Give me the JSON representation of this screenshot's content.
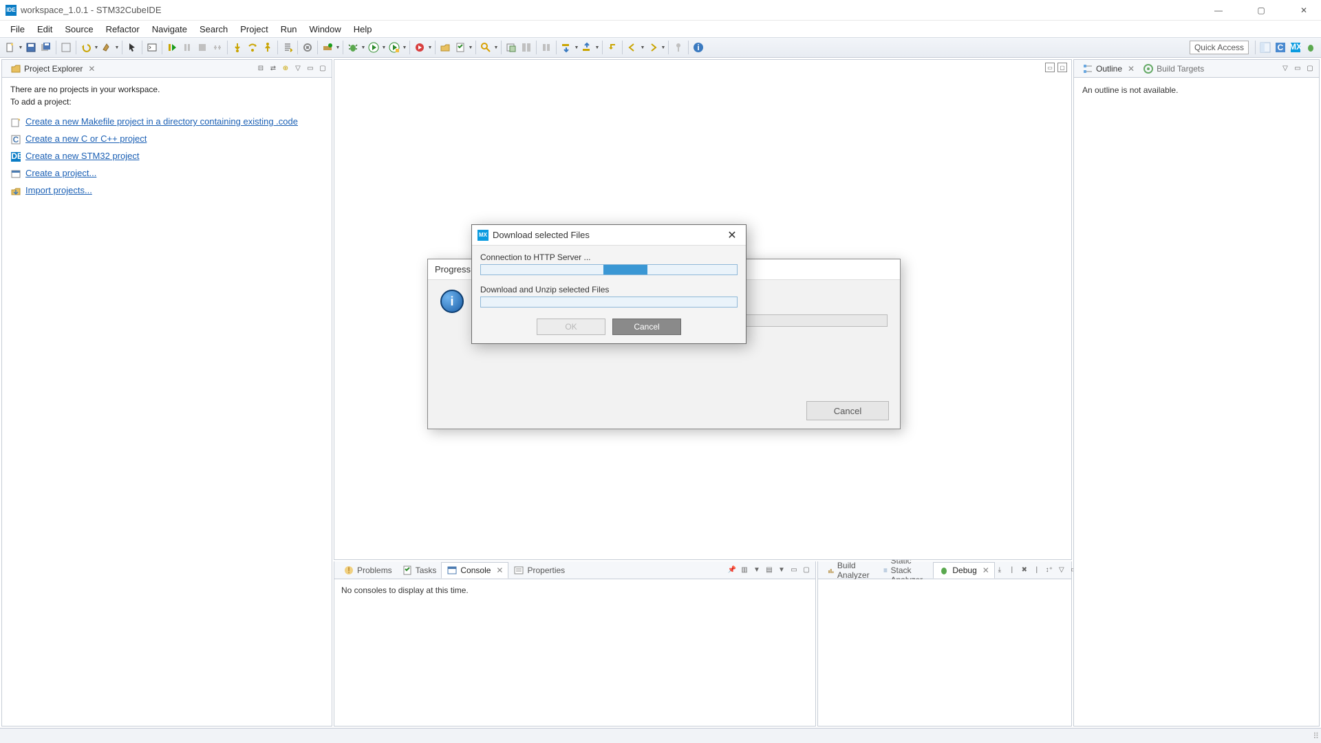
{
  "window": {
    "title": "workspace_1.0.1 - STM32CubeIDE",
    "app_badge": "IDE"
  },
  "menu": [
    "File",
    "Edit",
    "Source",
    "Refactor",
    "Navigate",
    "Search",
    "Project",
    "Run",
    "Window",
    "Help"
  ],
  "toolbar": {
    "quick_access": "Quick Access"
  },
  "project_explorer": {
    "title": "Project Explorer",
    "empty_msg1": "There are no projects in your workspace.",
    "empty_msg2": "To add a project:",
    "links": [
      "Create a new Makefile project in a directory containing existing .code",
      "Create a new C or C++ project",
      "Create a new STM32 project",
      "Create a project...",
      "Import projects..."
    ]
  },
  "outline": {
    "tab1": "Outline",
    "tab2": "Build Targets",
    "msg": "An outline is not available."
  },
  "bottom": {
    "tabs": [
      "Problems",
      "Tasks",
      "Console",
      "Properties"
    ],
    "active": "Console",
    "console_msg": "No consoles to display at this time.",
    "right_tabs": [
      "Build Analyzer",
      "Static Stack Analyzer",
      "Debug"
    ],
    "right_active": "Debug"
  },
  "progress_dialog": {
    "title": "Progress",
    "cancel": "Cancel"
  },
  "download_dialog": {
    "badge": "MX",
    "title": "Download selected Files",
    "task1": "Connection to HTTP Server ...",
    "task2": "Download and Unzip selected Files",
    "ok": "OK",
    "cancel": "Cancel"
  }
}
